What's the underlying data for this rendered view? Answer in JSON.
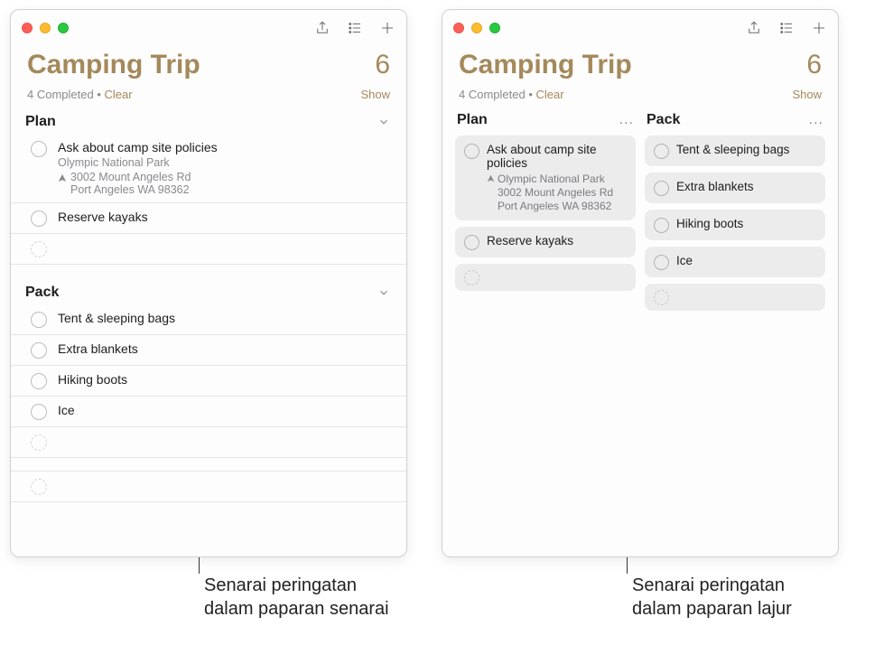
{
  "header": {
    "title": "Camping Trip",
    "count": "6",
    "completed_text": "4 Completed",
    "dot": " • ",
    "clear": "Clear",
    "show": "Show"
  },
  "sections": {
    "plan": {
      "title": "Plan",
      "items": [
        {
          "title": "Ask about camp site policies",
          "loc_name": "Olympic National Park",
          "loc_addr1": "3002 Mount Angeles Rd",
          "loc_addr2": "Port Angeles WA 98362"
        },
        {
          "title": "Reserve kayaks"
        }
      ]
    },
    "pack": {
      "title": "Pack",
      "items": [
        {
          "title": "Tent & sleeping bags"
        },
        {
          "title": "Extra blankets"
        },
        {
          "title": "Hiking boots"
        },
        {
          "title": "Ice"
        }
      ]
    }
  },
  "more_dots": "...",
  "icons": {
    "share": "share-icon",
    "list": "list-icon",
    "add": "add-icon",
    "chevron": "chevron-down-icon",
    "location": "location-icon"
  },
  "callouts": {
    "left_l1": "Senarai peringatan",
    "left_l2": "dalam paparan senarai",
    "right_l1": "Senarai peringatan",
    "right_l2": "dalam paparan lajur"
  }
}
